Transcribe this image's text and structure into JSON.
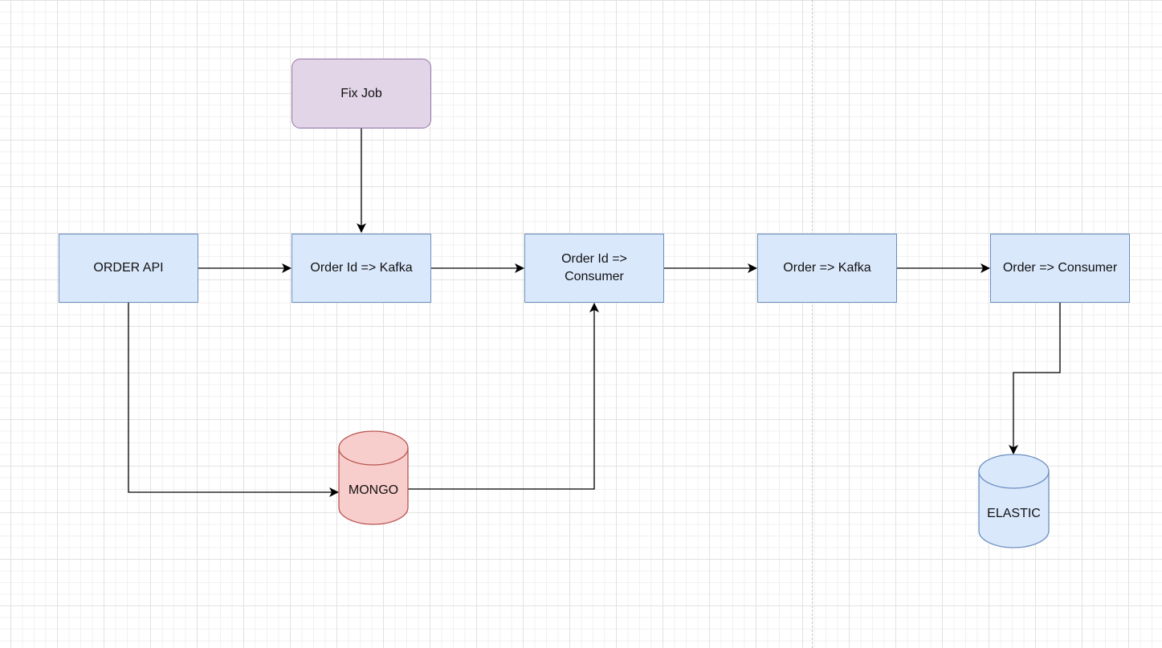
{
  "diagram": {
    "nodes": {
      "fix_job": {
        "label": "Fix Job",
        "shape": "rounded-rect",
        "fill": "#e1d5e7",
        "stroke": "#9673a6"
      },
      "order_api": {
        "label": "ORDER API",
        "shape": "rect",
        "fill": "#dae8fc",
        "stroke": "#6c8ebf"
      },
      "order_id_kafka": {
        "label": "Order Id => Kafka",
        "shape": "rect",
        "fill": "#dae8fc",
        "stroke": "#6c8ebf"
      },
      "order_id_consumer": {
        "label": "Order Id =>\nConsumer",
        "shape": "rect",
        "fill": "#dae8fc",
        "stroke": "#6c8ebf"
      },
      "order_kafka": {
        "label": "Order => Kafka",
        "shape": "rect",
        "fill": "#dae8fc",
        "stroke": "#6c8ebf"
      },
      "order_consumer": {
        "label": "Order => Consumer",
        "shape": "rect",
        "fill": "#dae8fc",
        "stroke": "#6c8ebf"
      },
      "mongo": {
        "label": "MONGO",
        "shape": "cylinder",
        "fill": "#f8cecc",
        "stroke": "#b85450"
      },
      "elastic": {
        "label": "ELASTIC",
        "shape": "cylinder",
        "fill": "#dae8fc",
        "stroke": "#6c8ebf"
      }
    },
    "edges": [
      {
        "from": "fix_job",
        "to": "order_id_kafka"
      },
      {
        "from": "order_api",
        "to": "order_id_kafka"
      },
      {
        "from": "order_id_kafka",
        "to": "order_id_consumer"
      },
      {
        "from": "order_id_consumer",
        "to": "order_kafka"
      },
      {
        "from": "order_kafka",
        "to": "order_consumer"
      },
      {
        "from": "order_api",
        "to": "mongo"
      },
      {
        "from": "mongo",
        "to": "order_id_consumer"
      },
      {
        "from": "order_consumer",
        "to": "elastic"
      }
    ],
    "edge_color": "#000000"
  }
}
